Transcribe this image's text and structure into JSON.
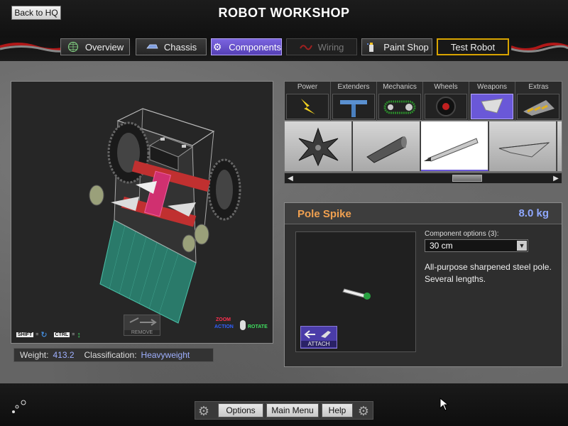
{
  "header": {
    "back_label": "Back to HQ",
    "title": "ROBOT WORKSHOP"
  },
  "nav": {
    "tabs": [
      {
        "label": "Overview",
        "icon": "globe-icon",
        "state": "normal"
      },
      {
        "label": "Chassis",
        "icon": "chassis-icon",
        "state": "normal"
      },
      {
        "label": "Components",
        "icon": "gear-icon",
        "state": "active"
      },
      {
        "label": "Wiring",
        "icon": "wire-icon",
        "state": "disabled"
      },
      {
        "label": "Paint Shop",
        "icon": "spray-can-icon",
        "state": "normal"
      },
      {
        "label": "Test Robot",
        "icon": "hazard-stripe-icon",
        "state": "hazard"
      }
    ]
  },
  "viewport": {
    "remove_label": "REMOVE",
    "hint_shift": "SHIFT",
    "hint_ctrl": "CTRL",
    "hint_action": "ACTION",
    "hint_zoom": "ZOOM",
    "hint_rotate": "ROTATE"
  },
  "stats": {
    "weight_label": "Weight:",
    "weight_value": "413.2",
    "class_label": "Classification:",
    "class_value": "Heavyweight"
  },
  "categories": [
    {
      "label": "Power",
      "icon": "lightning-icon"
    },
    {
      "label": "Extenders",
      "icon": "extender-icon"
    },
    {
      "label": "Mechanics",
      "icon": "chain-icon"
    },
    {
      "label": "Wheels",
      "icon": "wheel-icon"
    },
    {
      "label": "Weapons",
      "icon": "blade-icon",
      "active": true
    },
    {
      "label": "Extras",
      "icon": "hazard-plate-icon"
    }
  ],
  "items": [
    {
      "icon": "shuriken-icon"
    },
    {
      "icon": "cone-spike-icon"
    },
    {
      "icon": "pole-spike-icon",
      "selected": true
    },
    {
      "icon": "wedge-blade-icon"
    }
  ],
  "scroll": {
    "position": 0.63
  },
  "detail": {
    "name": "Pole Spike",
    "weight": "8.0 kg",
    "options_label": "Component options (3):",
    "selected_option": "30 cm",
    "description": "All-purpose sharpened steel pole. Several lengths.",
    "attach_label": "ATTACH"
  },
  "footer": {
    "options_label": "Options",
    "main_menu_label": "Main Menu",
    "help_label": "Help"
  },
  "colors": {
    "accent": "#6a58d8",
    "item_name": "#f0a050",
    "weight": "#8fa8ff"
  }
}
